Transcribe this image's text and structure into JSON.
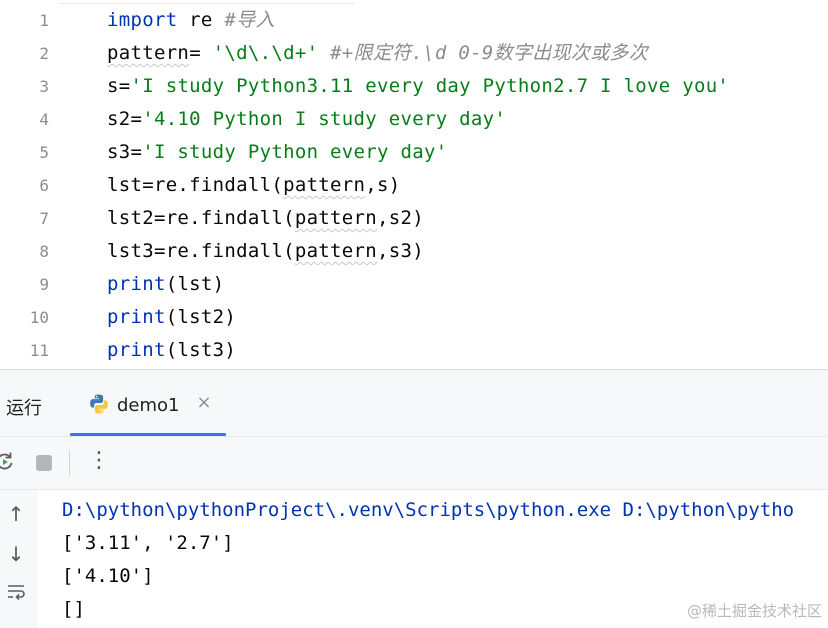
{
  "editor": {
    "line_numbers": [
      "1",
      "2",
      "3",
      "4",
      "5",
      "6",
      "7",
      "8",
      "9",
      "10",
      "11"
    ],
    "lines": [
      [
        {
          "t": "import",
          "c": "kw"
        },
        {
          "t": " re ",
          "c": ""
        },
        {
          "t": "#导入",
          "c": "cmt"
        }
      ],
      [
        {
          "t": "pattern",
          "c": "typo"
        },
        {
          "t": "= ",
          "c": ""
        },
        {
          "t": "'\\d\\.\\d+'",
          "c": "str"
        },
        {
          "t": " #+限定符.\\d 0-9数字出现次或多次",
          "c": "cmt"
        }
      ],
      [
        {
          "t": "s=",
          "c": ""
        },
        {
          "t": "'I study Python3.11 every day Python2.7 I love you'",
          "c": "str"
        }
      ],
      [
        {
          "t": "s2=",
          "c": ""
        },
        {
          "t": "'4.10 Python I study every day'",
          "c": "str"
        }
      ],
      [
        {
          "t": "s3=",
          "c": ""
        },
        {
          "t": "'I study Python every day'",
          "c": "str"
        }
      ],
      [
        {
          "t": "lst=re.findall(",
          "c": ""
        },
        {
          "t": "pattern",
          "c": "typo"
        },
        {
          "t": ",s)",
          "c": ""
        }
      ],
      [
        {
          "t": "lst2=re.findall(",
          "c": ""
        },
        {
          "t": "pattern",
          "c": "typo"
        },
        {
          "t": ",s2)",
          "c": ""
        }
      ],
      [
        {
          "t": "lst3=re.findall(",
          "c": ""
        },
        {
          "t": "pattern",
          "c": "typo"
        },
        {
          "t": ",s3)",
          "c": ""
        }
      ],
      [
        {
          "t": "print",
          "c": "fn"
        },
        {
          "t": "(lst)",
          "c": ""
        }
      ],
      [
        {
          "t": "print",
          "c": "fn"
        },
        {
          "t": "(lst2)",
          "c": ""
        }
      ],
      [
        {
          "t": "print",
          "c": "fn"
        },
        {
          "t": "(lst3)",
          "c": ""
        }
      ]
    ]
  },
  "run_panel": {
    "title": "运行",
    "tab_label": "demo1",
    "tab_icon": "python-icon",
    "close_glyph": "×",
    "more_glyph": "⋮",
    "up_glyph": "↑",
    "down_glyph": "↓",
    "console_lines": [
      "D:\\python\\pythonProject\\.venv\\Scripts\\python.exe D:\\python\\pytho",
      "['3.11', '2.7']",
      "['4.10']",
      "[]"
    ]
  },
  "watermark": "@稀土掘金技术社区",
  "colors": {
    "keyword": "#0033b3",
    "string": "#067d17",
    "comment": "#8c8c8c",
    "accent": "#3574f0"
  }
}
